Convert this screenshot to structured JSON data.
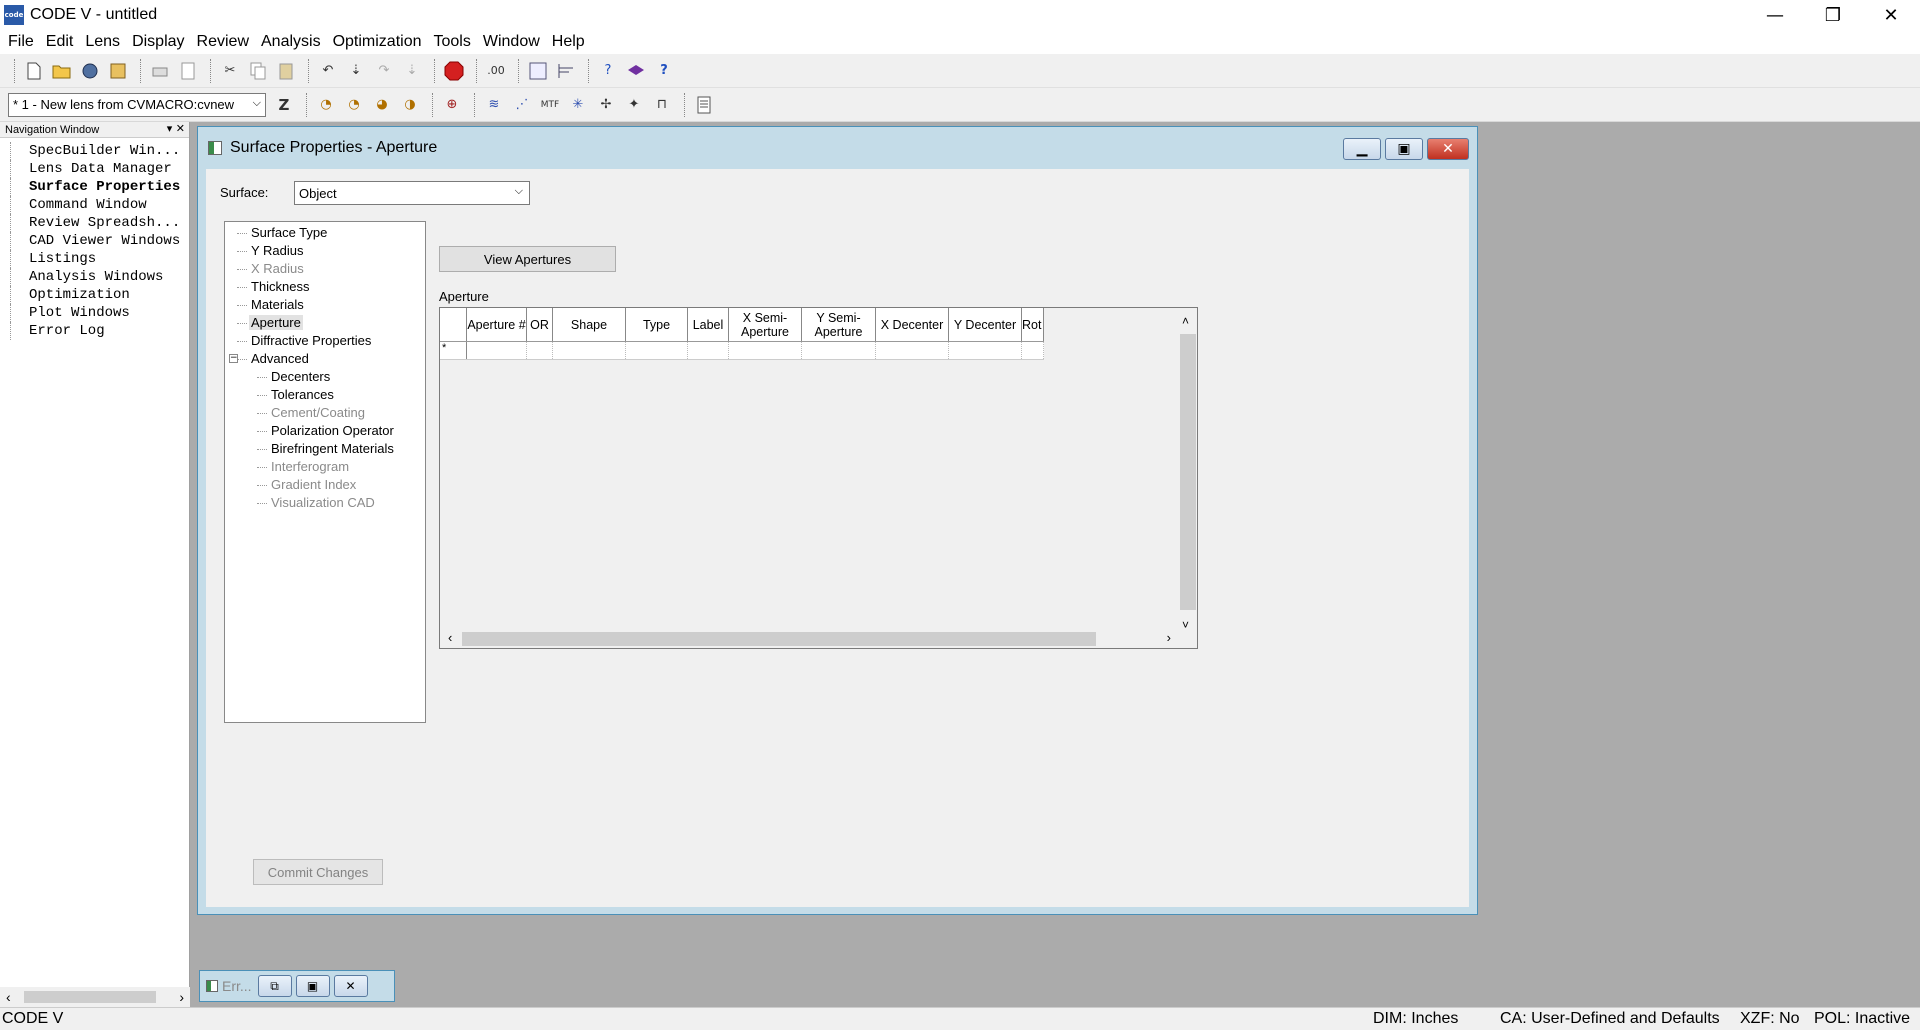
{
  "app": {
    "icon_text": "code",
    "title": "CODE V - untitled",
    "window_controls": {
      "minimize": "—",
      "restore": "❐",
      "close": "✕"
    }
  },
  "menu": [
    "File",
    "Edit",
    "Lens",
    "Display",
    "Review",
    "Analysis",
    "Optimization",
    "Tools",
    "Window",
    "Help"
  ],
  "toolbar2": {
    "lens_selector_value": "* 1 - New lens from CVMACRO:cvnew",
    "z_label": "Z"
  },
  "nav": {
    "header": "Navigation Window",
    "header_controls": "▾ ✕",
    "items": [
      "SpecBuilder Win...",
      "Lens Data Manager",
      "Surface Properties",
      "Command Window",
      "Review Spreadsh...",
      "CAD Viewer Windows",
      "Listings",
      "Analysis Windows",
      "Optimization",
      "Plot Windows",
      "Error Log"
    ],
    "active_index": 2
  },
  "dialog": {
    "title": "Surface Properties - Aperture",
    "surface_label": "Surface:",
    "surface_value": "Object",
    "tree": {
      "items": [
        {
          "label": "Surface Type",
          "level": 0,
          "enabled": true
        },
        {
          "label": "Y Radius",
          "level": 0,
          "enabled": true
        },
        {
          "label": "X Radius",
          "level": 0,
          "enabled": false
        },
        {
          "label": "Thickness",
          "level": 0,
          "enabled": true
        },
        {
          "label": "Materials",
          "level": 0,
          "enabled": true
        },
        {
          "label": "Aperture",
          "level": 0,
          "enabled": true,
          "selected": true
        },
        {
          "label": "Diffractive Properties",
          "level": 0,
          "enabled": true
        },
        {
          "label": "Advanced",
          "level": 0,
          "enabled": true,
          "expander": "−"
        },
        {
          "label": "Decenters",
          "level": 1,
          "enabled": true
        },
        {
          "label": "Tolerances",
          "level": 1,
          "enabled": true
        },
        {
          "label": "Cement/Coating",
          "level": 1,
          "enabled": false
        },
        {
          "label": "Polarization Operator",
          "level": 1,
          "enabled": true
        },
        {
          "label": "Birefringent Materials",
          "level": 1,
          "enabled": true
        },
        {
          "label": "Interferogram",
          "level": 1,
          "enabled": false
        },
        {
          "label": "Gradient Index",
          "level": 1,
          "enabled": false
        },
        {
          "label": "Visualization CAD",
          "level": 1,
          "enabled": false
        }
      ]
    },
    "view_apertures_label": "View Apertures",
    "aperture_label": "Aperture",
    "grid": {
      "columns": [
        "",
        "Aperture #",
        "OR",
        "Shape",
        "Type",
        "Label",
        "X Semi-Aperture",
        "Y Semi-Aperture",
        "X Decenter",
        "Y Decenter",
        "Rot"
      ],
      "new_row_marker": "*"
    },
    "commit_label": "Commit Changes"
  },
  "minimized_window": {
    "title": "Err..."
  },
  "status": {
    "left": "CODE V",
    "dim": "DIM: Inches",
    "ca": "CA: User-Defined and Defaults",
    "xzf": "XZF: No",
    "pol": "POL: Inactive"
  }
}
